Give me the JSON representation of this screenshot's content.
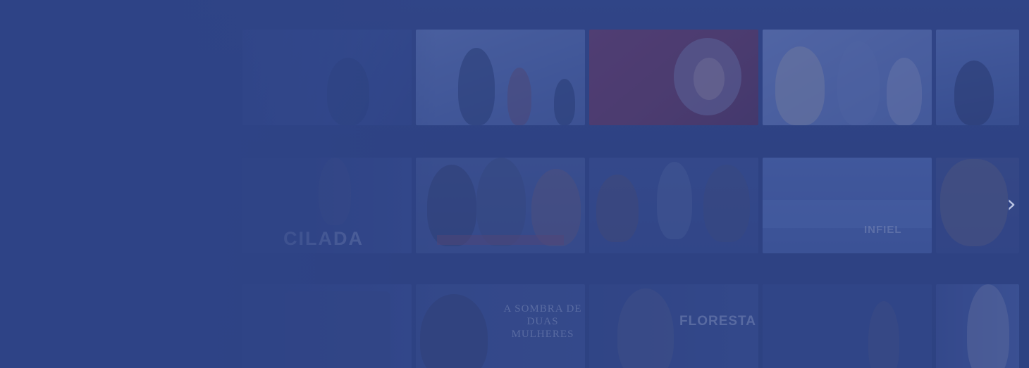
{
  "rows": [
    {
      "tiles": [
        {
          "caption": ""
        },
        {
          "caption": ""
        },
        {
          "caption": ""
        },
        {
          "caption": ""
        },
        {
          "caption": ""
        }
      ]
    },
    {
      "tiles": [
        {
          "caption": "CILADA"
        },
        {
          "caption": ""
        },
        {
          "caption": ""
        },
        {
          "caption": "INFIEL"
        },
        {
          "caption": ""
        }
      ]
    },
    {
      "tiles": [
        {
          "caption": ""
        },
        {
          "caption": "A SOMBRA DE DUAS MULHERES"
        },
        {
          "caption": "FLORESTA"
        },
        {
          "caption": ""
        },
        {
          "caption": ""
        }
      ]
    }
  ],
  "navigation": {
    "next_icon": "chevron-right-icon",
    "next_glyph": "›"
  },
  "colors": {
    "overlay": "#2f4583",
    "tile_red": "#7a2f4f",
    "tile_light": "#6f86c6"
  }
}
